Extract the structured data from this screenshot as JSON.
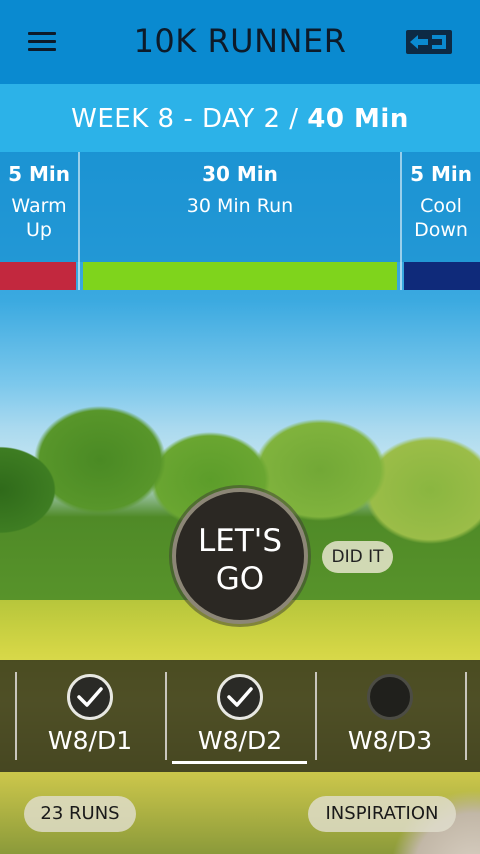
{
  "header": {
    "title": "10K RUNNER",
    "menu_icon": "hamburger-menu-icon",
    "logout_icon": "logout-arrow-icon"
  },
  "week": {
    "prefix": "WEEK 8 - DAY 2 / ",
    "total": "40 Min"
  },
  "segments": [
    {
      "duration": "5 Min",
      "label_line1": "Warm",
      "label_line2": "Up",
      "color": "#c2283e"
    },
    {
      "duration": "30 Min",
      "label_line1": "30 Min Run",
      "label_line2": "",
      "color": "#7fd41c"
    },
    {
      "duration": "5 Min",
      "label_line1": "Cool",
      "label_line2": "Down",
      "color": "#0f2a7a"
    }
  ],
  "start_button": {
    "line1": "LET'S",
    "line2": "GO"
  },
  "did_it_label": "DID IT",
  "days": [
    {
      "label": "W8/D1",
      "completed": true,
      "icon": "check-icon"
    },
    {
      "label": "W8/D2",
      "completed": true,
      "icon": "check-icon",
      "selected": true
    },
    {
      "label": "W8/D3",
      "completed": false,
      "icon": "empty-circle-icon"
    }
  ],
  "footer": {
    "runs_label": "23 RUNS",
    "inspiration_label": "INSPIRATION"
  }
}
